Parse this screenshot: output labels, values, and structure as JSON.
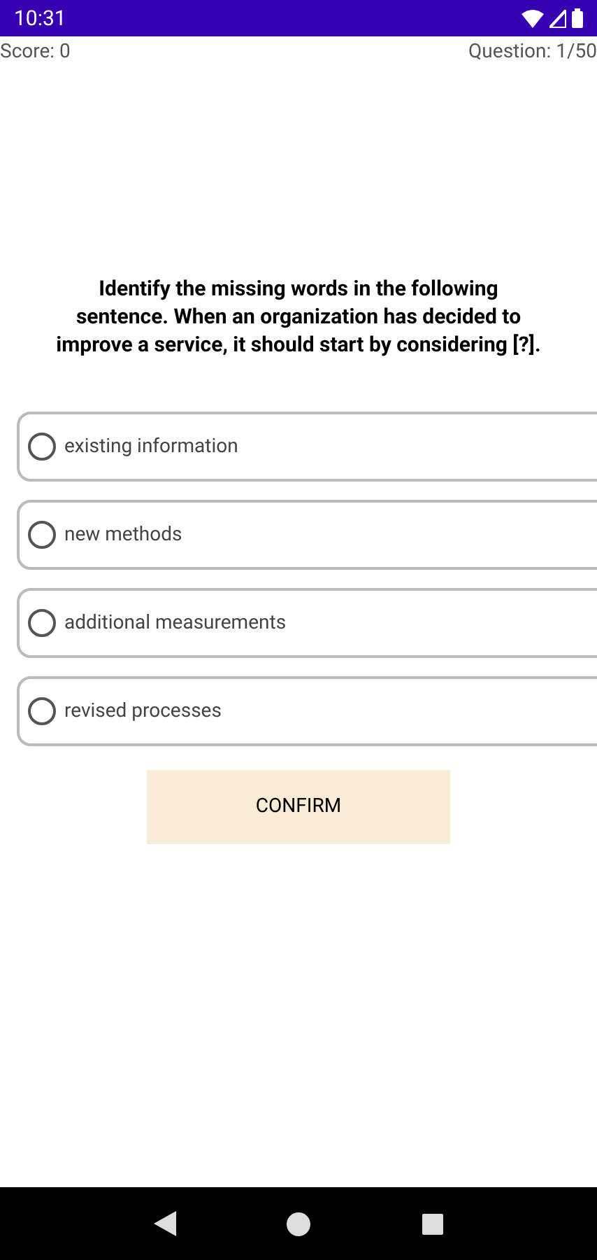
{
  "status_bar": {
    "time": "10:31"
  },
  "header": {
    "score": "Score: 0",
    "progress": "Question: 1/50"
  },
  "question": "Identify the missing words in the following sentence. When an organization has decided to improve a service, it should start by considering [?].",
  "options": [
    {
      "label": "existing information",
      "selected": false
    },
    {
      "label": "new methods",
      "selected": false
    },
    {
      "label": "additional measurements",
      "selected": false
    },
    {
      "label": "revised processes",
      "selected": false
    }
  ],
  "confirm_button": "CONFIRM"
}
